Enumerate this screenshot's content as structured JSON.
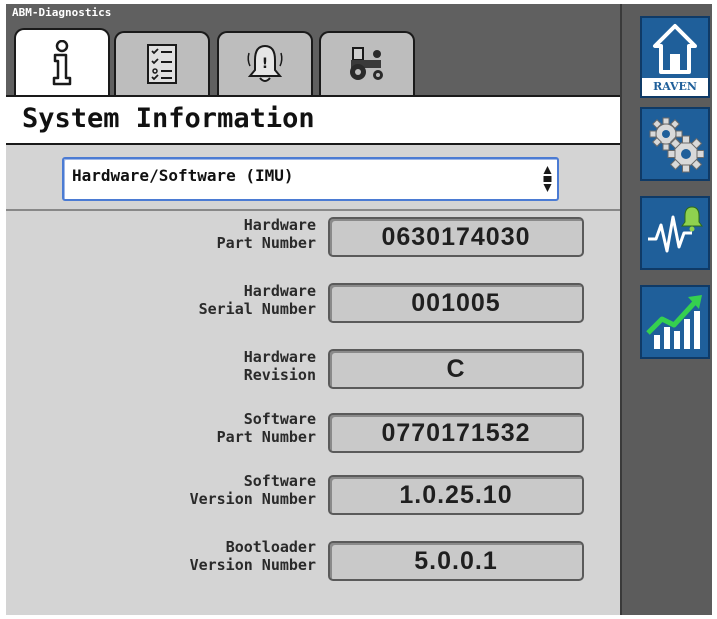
{
  "window": {
    "title": "ABM-Diagnostics"
  },
  "tabs": [
    {
      "icon": "info-icon",
      "active": true
    },
    {
      "icon": "checklist-icon",
      "active": false
    },
    {
      "icon": "alarm-bell-icon",
      "active": false
    },
    {
      "icon": "tractor-icon",
      "active": false
    }
  ],
  "header": {
    "title": "System Information"
  },
  "selector": {
    "value": "Hardware/Software (IMU)"
  },
  "rows": [
    {
      "label_line1": "Hardware",
      "label_line2": "Part Number",
      "value": "0630174030"
    },
    {
      "label_line1": "Hardware",
      "label_line2": "Serial Number",
      "value": "001005"
    },
    {
      "label_line1": "Hardware",
      "label_line2": "Revision",
      "value": "C"
    },
    {
      "label_line1": "Software",
      "label_line2": "Part Number",
      "value": "0770171532"
    },
    {
      "label_line1": "Software",
      "label_line2": "Version Number",
      "value": "1.0.25.10"
    },
    {
      "label_line1": "Bootloader",
      "label_line2": "Version Number",
      "value": "5.0.0.1"
    }
  ],
  "sidebar": {
    "home": {
      "icon": "home-icon",
      "brand": "RAVEN"
    },
    "settings": {
      "icon": "gears-icon"
    },
    "diagnostics": {
      "icon": "alarm-graph-icon"
    },
    "performance": {
      "icon": "trend-chart-icon"
    }
  },
  "colors": {
    "frame": "#606060",
    "content": "#d4d4d4",
    "sidebar_button": "#1f5f9a",
    "selector_border": "#4b7bd3"
  }
}
